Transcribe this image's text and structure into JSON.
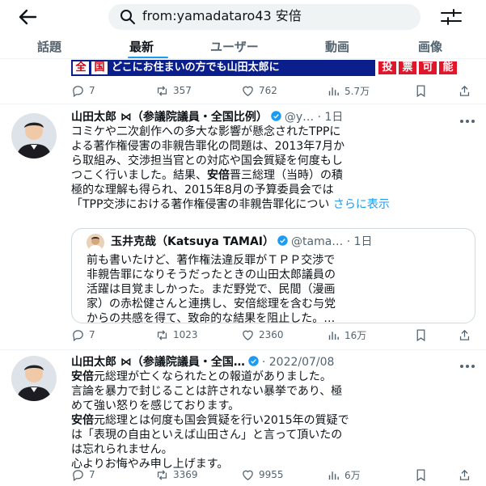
{
  "search": {
    "query": "from:yamadataro43 安倍"
  },
  "tabs": [
    {
      "label": "話題"
    },
    {
      "label": "最新"
    },
    {
      "label": "ユーザー"
    },
    {
      "label": "動画"
    },
    {
      "label": "画像"
    }
  ],
  "active_tab": "最新",
  "banner": {
    "box1": "全",
    "box2": "国",
    "text": "どこにお住まいの方でも山田太郎に",
    "red": [
      "投",
      "票",
      "可",
      "能"
    ]
  },
  "tweet0_stats": {
    "replies": "7",
    "retweets": "357",
    "likes": "762",
    "views": "5.7万"
  },
  "tweet1": {
    "name": "山田太郎 ⋈（参議院議員・全国比例）",
    "handle_time": "@y… · 1日",
    "lines": [
      {
        "pre": "コミケや二次創作への多大な影響が懸念されたTPPに",
        "hl": "",
        "post": ""
      },
      {
        "pre": "よる著作権侵害の非親告罪化の問題は、2013年7月か",
        "hl": "",
        "post": ""
      },
      {
        "pre": "ら取組み、交渉担当官との対応や国会質疑を何度もし",
        "hl": "",
        "post": ""
      },
      {
        "pre": "つこく行いました。結果、",
        "hl": "安倍",
        "post": "晋三総理（当時）の積"
      },
      {
        "pre": "極的な理解も得られ、2015年8月の予算委員会では",
        "hl": "",
        "post": ""
      },
      {
        "pre": "「TPP交渉における著作権侵害の非親告罪化につい",
        "hl": "",
        "post": ""
      }
    ],
    "show_more": "さらに表示",
    "stats": {
      "replies": "7",
      "retweets": "1023",
      "likes": "2360",
      "views": "16万"
    }
  },
  "quote": {
    "name": "玉井克哉（Katsuya TAMAI）",
    "handle_time": "@tama… · 1日",
    "lines": [
      "前も書いたけど、著作権法違反罪がＴＰＰ交渉で",
      "非親告罪になりそうだったときの山田太郎議員の",
      "活躍は目覚ましかった。まだ野党で、民間（漫画",
      "家）の赤松健さんと連携し、安倍総理を含む与党",
      "からの共感を得て、致命的な結果を阻止した。…"
    ]
  },
  "tweet2": {
    "name": "山田太郎 ⋈（参議院議員・全国…",
    "handle_time": "· 2022/07/08",
    "lines": [
      {
        "pre": "",
        "hl": "安倍",
        "post": "元総理が亡くなられたとの報道がありました。"
      },
      {
        "pre": "言論を暴力で封じることは許されない暴挙であり、極",
        "hl": "",
        "post": ""
      },
      {
        "pre": "めて強い怒りを感じております。",
        "hl": "",
        "post": ""
      },
      {
        "pre": "",
        "hl": "安倍",
        "post": "元総理とは何度も国会質疑を行い2015年の質疑で"
      },
      {
        "pre": "は「表現の自由といえば山田さん」と言って頂いたの",
        "hl": "",
        "post": ""
      },
      {
        "pre": "は忘れられません。",
        "hl": "",
        "post": ""
      },
      {
        "pre": "心よりお悔やみ申し上げます。",
        "hl": "",
        "post": ""
      }
    ],
    "stats": {
      "replies": "7",
      "retweets": "3369",
      "likes": "9955",
      "views": "6万"
    }
  },
  "colors": {
    "accent": "#1d9bf0",
    "text": "#0f1419",
    "muted": "#536471",
    "border": "#eff3f4"
  }
}
